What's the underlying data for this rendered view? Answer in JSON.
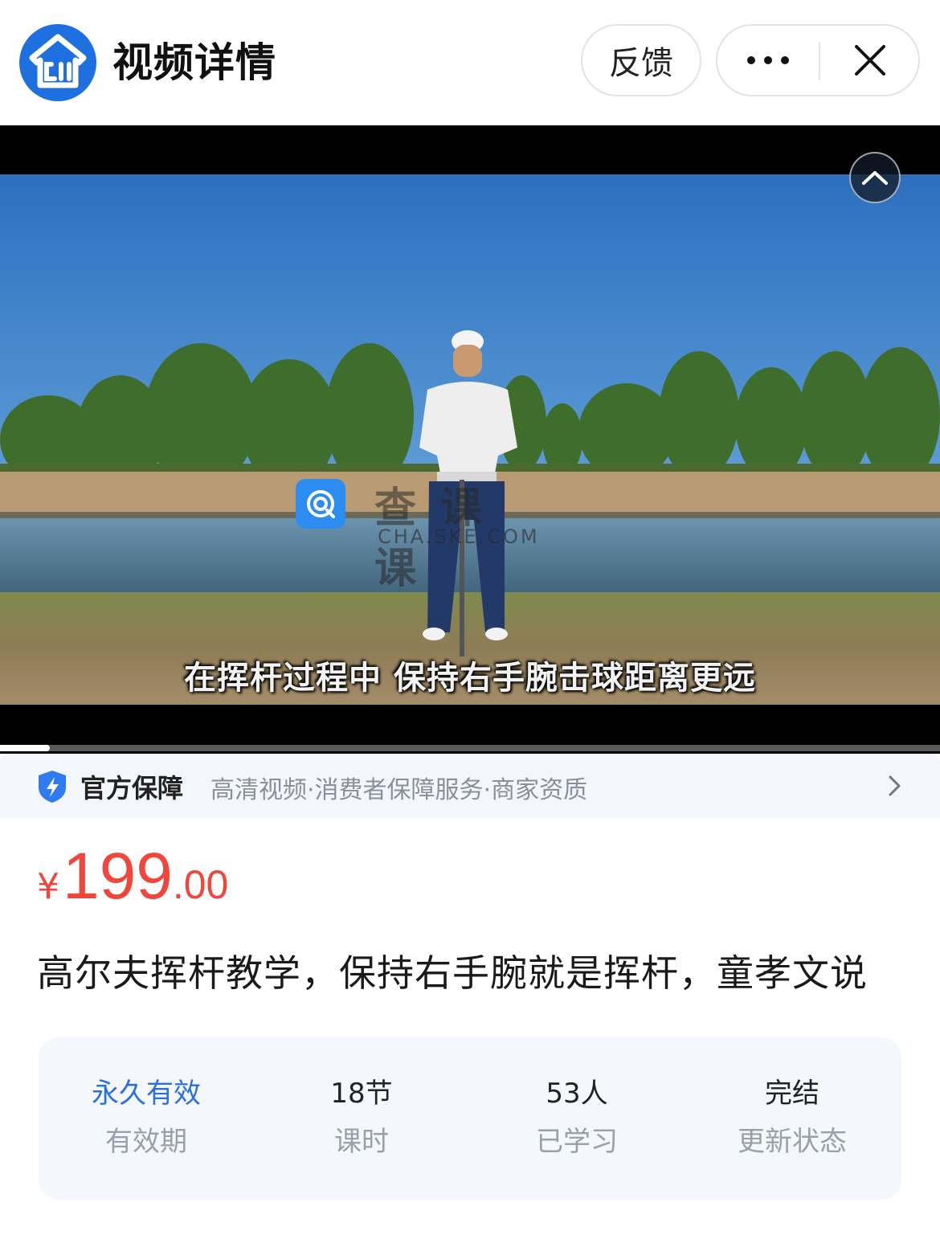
{
  "header": {
    "app_icon": "house-logo-icon",
    "title": "视频详情",
    "feedback_label": "反馈",
    "more_icon": "more-dots-icon",
    "close_icon": "close-icon"
  },
  "video": {
    "subtitle": "在挥杆过程中 保持右手腕击球距离更远",
    "watermark_name": "查课课",
    "watermark_url": "CHA.SKE.COM",
    "collapse_icon": "chevron-up-icon",
    "progress_fraction": 0.053
  },
  "guarantee": {
    "icon": "shield-bolt-icon",
    "title": "官方保障",
    "items": "高清视频·消费者保障服务·商家资质",
    "chevron_icon": "chevron-right-icon"
  },
  "price": {
    "currency": "¥",
    "integer": "199",
    "decimal": ".00",
    "color": "#f0463c"
  },
  "course": {
    "title": "高尔夫挥杆教学，保持右手腕就是挥杆，童孝文说"
  },
  "stats": [
    {
      "value": "永久有效",
      "label": "有效期"
    },
    {
      "value": "18节",
      "label": "课时"
    },
    {
      "value": "53人",
      "label": "已学习"
    },
    {
      "value": "完结",
      "label": "更新状态"
    }
  ],
  "colors": {
    "accent": "#2a6fdb",
    "brand": "#1e6fe0"
  }
}
